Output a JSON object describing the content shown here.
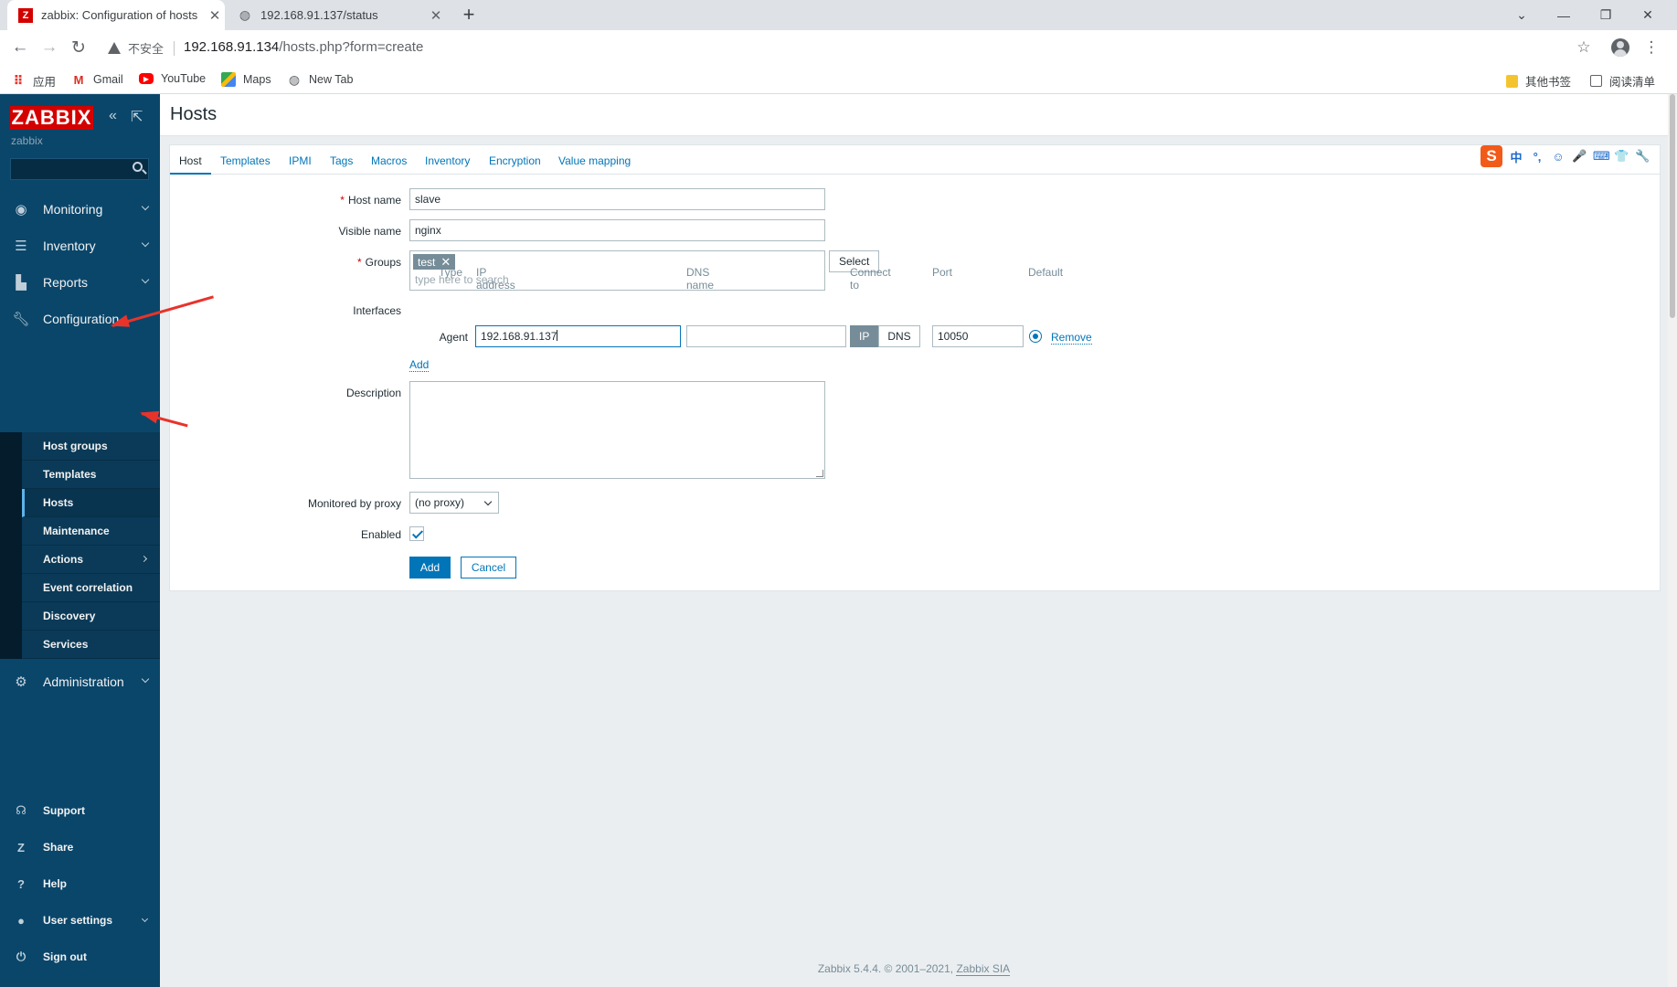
{
  "browser": {
    "tabs": [
      {
        "title": "zabbix: Configuration of hosts",
        "active": true,
        "favicon": "zabbix-favicon"
      },
      {
        "title": "192.168.91.137/status",
        "active": false,
        "favicon": "globe-icon"
      }
    ],
    "new_tab": "+",
    "security_label": "不安全",
    "url_host": "192.168.91.134",
    "url_path": "/hosts.php?form=create",
    "bookmarks": [
      {
        "label": "应用",
        "icon": "apps-grid-icon"
      },
      {
        "label": "Gmail",
        "icon": "gmail-icon"
      },
      {
        "label": "YouTube",
        "icon": "youtube-icon"
      },
      {
        "label": "Maps",
        "icon": "maps-icon"
      },
      {
        "label": "New Tab",
        "icon": "globe-icon"
      },
      {
        "label": "其他书签",
        "icon": "folder-icon"
      },
      {
        "label": "阅读清单",
        "icon": "reading-list-icon"
      }
    ]
  },
  "sidebar": {
    "logo": "ZABBIX",
    "server_name": "zabbix",
    "menu": [
      {
        "label": "Monitoring",
        "icon": "eye-icon"
      },
      {
        "label": "Inventory",
        "icon": "list-icon"
      },
      {
        "label": "Reports",
        "icon": "bar-chart-icon"
      },
      {
        "label": "Configuration",
        "icon": "wrench-icon"
      },
      {
        "label": "Administration",
        "icon": "gear-icon"
      }
    ],
    "config_submenu": [
      "Host groups",
      "Templates",
      "Hosts",
      "Maintenance",
      "Actions",
      "Event correlation",
      "Discovery",
      "Services"
    ],
    "active_submenu": "Hosts",
    "bottom": [
      {
        "label": "Support",
        "icon": "headset-icon"
      },
      {
        "label": "Share",
        "icon": "share-icon"
      },
      {
        "label": "Help",
        "icon": "help-icon"
      },
      {
        "label": "User settings",
        "icon": "user-icon"
      },
      {
        "label": "Sign out",
        "icon": "power-icon"
      }
    ]
  },
  "page": {
    "title": "Hosts",
    "form_tabs": [
      "Host",
      "Templates",
      "IPMI",
      "Tags",
      "Macros",
      "Inventory",
      "Encryption",
      "Value mapping"
    ],
    "active_tab": "Host",
    "fields": {
      "host_name_label": "Host name",
      "host_name_value": "slave",
      "visible_name_label": "Visible name",
      "visible_name_value": "nginx",
      "groups_label": "Groups",
      "group_chip": "test",
      "groups_placeholder": "type here to search",
      "select_button": "Select",
      "interfaces_label": "Interfaces",
      "interface_headers": [
        "Type",
        "IP address",
        "DNS name",
        "Connect to",
        "Port",
        "Default"
      ],
      "interface_type": "Agent",
      "ip_value": "192.168.91.137",
      "dns_value": "",
      "connect_ip": "IP",
      "connect_dns": "DNS",
      "port_value": "10050",
      "remove_link": "Remove",
      "add_link": "Add",
      "description_label": "Description",
      "proxy_label": "Monitored by proxy",
      "proxy_value": "(no proxy)",
      "enabled_label": "Enabled",
      "enabled": true
    },
    "buttons": {
      "add": "Add",
      "cancel": "Cancel"
    },
    "footer": {
      "text": "Zabbix 5.4.4. © 2001–2021,",
      "link": "Zabbix SIA"
    }
  },
  "ime_toolbar": {
    "logo": "S",
    "items": [
      "中",
      "°,",
      "☺",
      "🎤",
      "⌨",
      "👕",
      "🔧"
    ]
  }
}
